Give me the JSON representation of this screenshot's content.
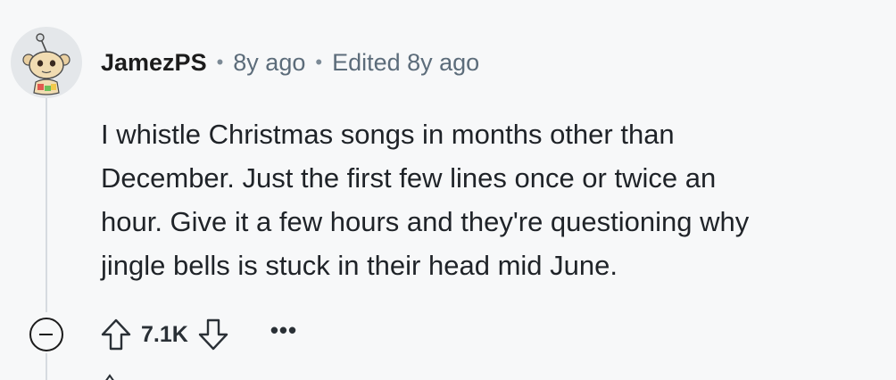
{
  "comment": {
    "author": "JamezPS",
    "separator": "•",
    "posted": "8y ago",
    "edited": "Edited 8y ago",
    "body": [
      "I whistle Christmas songs in months other than",
      "December. Just the first few lines once or twice an",
      "hour. Give it a few hours and they're questioning why",
      "jingle bells is stuck in their head mid June."
    ],
    "score": "7.1K",
    "more_label": "•••"
  },
  "icons": {
    "avatar": "snoo-avatar-icon",
    "collapse": "collapse-minus-icon",
    "upvote": "upvote-arrow-icon",
    "downvote": "downvote-arrow-icon",
    "more": "more-options-icon"
  },
  "colors": {
    "background": "#f7f8f9",
    "thread_line": "#d6dbe0",
    "username": "#1c1c1c",
    "meta": "#5c6c7a",
    "body": "#1f2328"
  }
}
